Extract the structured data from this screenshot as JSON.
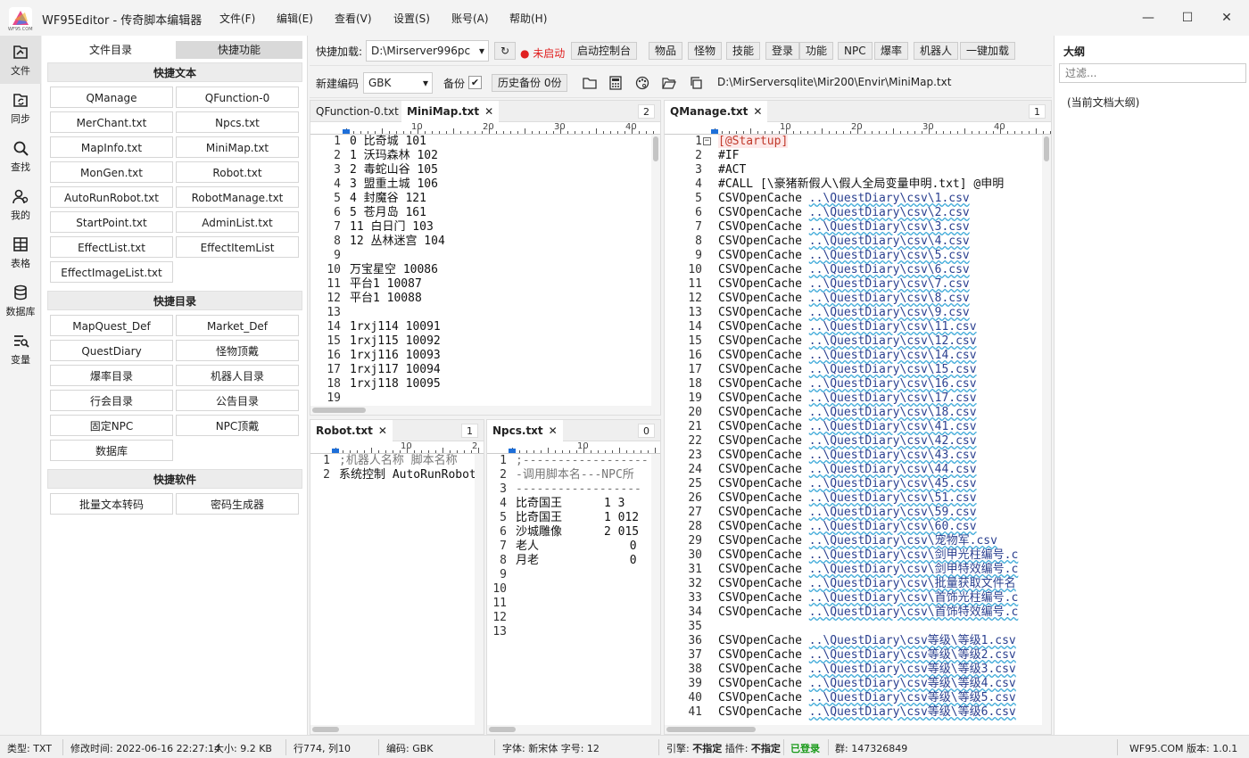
{
  "app": {
    "title": "WF95Editor - 传奇脚本编辑器",
    "logo_text": "WF95.COM"
  },
  "menu": [
    "文件(F)",
    "编辑(E)",
    "查看(V)",
    "设置(S)",
    "账号(A)",
    "帮助(H)"
  ],
  "rail": [
    "文件",
    "同步",
    "查找",
    "我的",
    "表格",
    "数据库",
    "变量"
  ],
  "left": {
    "tabs": [
      "文件目录",
      "快捷功能"
    ],
    "sections": [
      {
        "title": "快捷文本",
        "items": [
          "QManage",
          "QFunction-0",
          "MerChant.txt",
          "Npcs.txt",
          "MapInfo.txt",
          "MiniMap.txt",
          "MonGen.txt",
          "Robot.txt",
          "AutoRunRobot.txt",
          "RobotManage.txt",
          "StartPoint.txt",
          "AdminList.txt",
          "EffectList.txt",
          "EffectItemList",
          "EffectImageList.txt"
        ]
      },
      {
        "title": "快捷目录",
        "items": [
          "MapQuest_Def",
          "Market_Def",
          "QuestDiary",
          "怪物顶戴",
          "爆率目录",
          "机器人目录",
          "行会目录",
          "公告目录",
          "固定NPC",
          "NPC顶戴",
          "数据库"
        ]
      },
      {
        "title": "快捷软件",
        "items": [
          "批量文本转码",
          "密码生成器"
        ]
      }
    ]
  },
  "toolbar": {
    "quickload_label": "快捷加载:",
    "quickload_value": "D:\\Mirserver996pc",
    "status_text": "● 未启动",
    "status_color": "#e02020",
    "buttons": [
      "启动控制台",
      "物品",
      "怪物",
      "技能",
      "登录",
      "功能",
      "NPC",
      "爆率",
      "机器人",
      "一键加载"
    ],
    "encoding_label": "新建编码",
    "encoding_value": "GBK",
    "backup_label": "备份",
    "backup_checked": "✔",
    "history_button": "历史备份 0份",
    "path": "D:\\MirServersqlite\\Mir200\\Envir\\MiniMap.txt"
  },
  "editors": {
    "tl": {
      "tabs": [
        "QFunction-0.txt",
        "MiniMap.txt"
      ],
      "active": 1,
      "count": "2",
      "lines": [
        "0 比奇城 101",
        "1 沃玛森林 102",
        "2 毒蛇山谷 105",
        "3 盟重土城 106",
        "4 封魔谷 121",
        "5 苍月岛 161",
        "11 白日门 103",
        "12 丛林迷宫 104",
        "",
        "万宝星空 10086",
        "平台1 10087",
        "平台1 10088",
        "",
        "1rxj114 10091",
        "1rxj115 10092",
        "1rxj116 10093",
        "1rxj117 10094",
        "1rxj118 10095",
        ""
      ],
      "ruler": [
        "10",
        "20",
        "30",
        "40"
      ]
    },
    "bl": {
      "tabs": [
        "Robot.txt"
      ],
      "active": 0,
      "count": "1",
      "lines": [
        ";机器人名称 脚本名称",
        "系统控制 AutoRunRobot"
      ],
      "ruler": [
        "10",
        "2"
      ]
    },
    "bm": {
      "tabs": [
        "Npcs.txt"
      ],
      "active": 0,
      "count": "0",
      "lines": [
        ";------------------",
        "-调用脚本名---NPC所",
        "------------------",
        "比奇国王      1 3",
        "比奇国王      1 012",
        "沙城雕像      2 015",
        "老人             0",
        "月老             0",
        "",
        "",
        "",
        "",
        ""
      ],
      "ruler": [
        "10"
      ]
    },
    "right": {
      "tabs": [
        "QManage.txt"
      ],
      "active": 0,
      "count": "1",
      "lines": [
        {
          "p": "[@Startup]",
          "l": ""
        },
        {
          "p": "#IF",
          "l": ""
        },
        {
          "p": "#ACT",
          "l": ""
        },
        {
          "p": "#CALL [\\豪猪新假人\\假人全局变量申明.txt] @申明",
          "l": ""
        },
        {
          "p": "CSVOpenCache ",
          "l": "..\\QuestDiary\\csv\\1.csv"
        },
        {
          "p": "CSVOpenCache ",
          "l": "..\\QuestDiary\\csv\\2.csv"
        },
        {
          "p": "CSVOpenCache ",
          "l": "..\\QuestDiary\\csv\\3.csv"
        },
        {
          "p": "CSVOpenCache ",
          "l": "..\\QuestDiary\\csv\\4.csv"
        },
        {
          "p": "CSVOpenCache ",
          "l": "..\\QuestDiary\\csv\\5.csv"
        },
        {
          "p": "CSVOpenCache ",
          "l": "..\\QuestDiary\\csv\\6.csv"
        },
        {
          "p": "CSVOpenCache ",
          "l": "..\\QuestDiary\\csv\\7.csv"
        },
        {
          "p": "CSVOpenCache ",
          "l": "..\\QuestDiary\\csv\\8.csv"
        },
        {
          "p": "CSVOpenCache ",
          "l": "..\\QuestDiary\\csv\\9.csv"
        },
        {
          "p": "CSVOpenCache ",
          "l": "..\\QuestDiary\\csv\\11.csv"
        },
        {
          "p": "CSVOpenCache ",
          "l": "..\\QuestDiary\\csv\\12.csv"
        },
        {
          "p": "CSVOpenCache ",
          "l": "..\\QuestDiary\\csv\\14.csv"
        },
        {
          "p": "CSVOpenCache ",
          "l": "..\\QuestDiary\\csv\\15.csv"
        },
        {
          "p": "CSVOpenCache ",
          "l": "..\\QuestDiary\\csv\\16.csv"
        },
        {
          "p": "CSVOpenCache ",
          "l": "..\\QuestDiary\\csv\\17.csv"
        },
        {
          "p": "CSVOpenCache ",
          "l": "..\\QuestDiary\\csv\\18.csv"
        },
        {
          "p": "CSVOpenCache ",
          "l": "..\\QuestDiary\\csv\\41.csv"
        },
        {
          "p": "CSVOpenCache ",
          "l": "..\\QuestDiary\\csv\\42.csv"
        },
        {
          "p": "CSVOpenCache ",
          "l": "..\\QuestDiary\\csv\\43.csv"
        },
        {
          "p": "CSVOpenCache ",
          "l": "..\\QuestDiary\\csv\\44.csv"
        },
        {
          "p": "CSVOpenCache ",
          "l": "..\\QuestDiary\\csv\\45.csv"
        },
        {
          "p": "CSVOpenCache ",
          "l": "..\\QuestDiary\\csv\\51.csv"
        },
        {
          "p": "CSVOpenCache ",
          "l": "..\\QuestDiary\\csv\\59.csv"
        },
        {
          "p": "CSVOpenCache ",
          "l": "..\\QuestDiary\\csv\\60.csv"
        },
        {
          "p": "CSVOpenCache ",
          "l": "..\\QuestDiary\\csv\\宠物军.csv"
        },
        {
          "p": "CSVOpenCache ",
          "l": "..\\QuestDiary\\csv\\剑甲光柱编号.c"
        },
        {
          "p": "CSVOpenCache ",
          "l": "..\\QuestDiary\\csv\\剑甲特效编号.c"
        },
        {
          "p": "CSVOpenCache ",
          "l": "..\\QuestDiary\\csv\\批量获取文件名"
        },
        {
          "p": "CSVOpenCache ",
          "l": "..\\QuestDiary\\csv\\首饰光柱编号.c"
        },
        {
          "p": "CSVOpenCache ",
          "l": "..\\QuestDiary\\csv\\首饰特效编号.c"
        },
        {
          "p": "",
          "l": ""
        },
        {
          "p": "CSVOpenCache ",
          "l": "..\\QuestDiary\\csv等级\\等级1.csv"
        },
        {
          "p": "CSVOpenCache ",
          "l": "..\\QuestDiary\\csv等级\\等级2.csv"
        },
        {
          "p": "CSVOpenCache ",
          "l": "..\\QuestDiary\\csv等级\\等级3.csv"
        },
        {
          "p": "CSVOpenCache ",
          "l": "..\\QuestDiary\\csv等级\\等级4.csv"
        },
        {
          "p": "CSVOpenCache ",
          "l": "..\\QuestDiary\\csv等级\\等级5.csv"
        },
        {
          "p": "CSVOpenCache ",
          "l": "..\\QuestDiary\\csv等级\\等级6.csv"
        }
      ],
      "ruler": [
        "10",
        "20",
        "30",
        "40"
      ]
    }
  },
  "outline": {
    "title": "大纲",
    "filter_placeholder": "过滤...",
    "item": "(当前文档大纲)"
  },
  "status": {
    "type": "类型: TXT",
    "mtime": "修改时间: 2022-06-16 22:27:14",
    "size": "大小: 9.2 KB",
    "pos": "行774, 列10",
    "enc": "编码: GBK",
    "font": "字体: 新宋体  字号: 12",
    "engine": "引擎: ",
    "engine_v": "不指定",
    "plugin": " 插件: ",
    "plugin_v": "不指定",
    "login": "已登录",
    "login_color": "#1a9a1a",
    "group": "群: 147326849",
    "site": "WF95.COM  版本: 1.0.1"
  }
}
